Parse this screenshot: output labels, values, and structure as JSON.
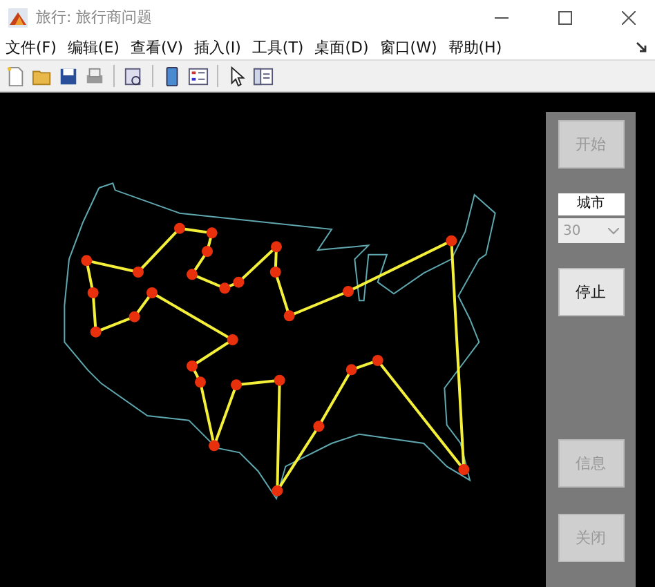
{
  "window": {
    "title": "旅行: 旅行商问题"
  },
  "menu": [
    "文件(F)",
    "编辑(E)",
    "查看(V)",
    "插入(I)",
    "工具(T)",
    "桌面(D)",
    "窗口(W)",
    "帮助(H)"
  ],
  "panel": {
    "upper_buttons": [
      {
        "label": "开始",
        "disabled": true
      }
    ],
    "city_label": "城市",
    "city_select": {
      "value": "30",
      "disabled": true
    },
    "middle_buttons": [
      {
        "label": "停止",
        "disabled": false
      }
    ],
    "lower_buttons": [
      {
        "label": "信息",
        "disabled": true
      },
      {
        "label": "关闭",
        "disabled": true
      }
    ]
  }
}
